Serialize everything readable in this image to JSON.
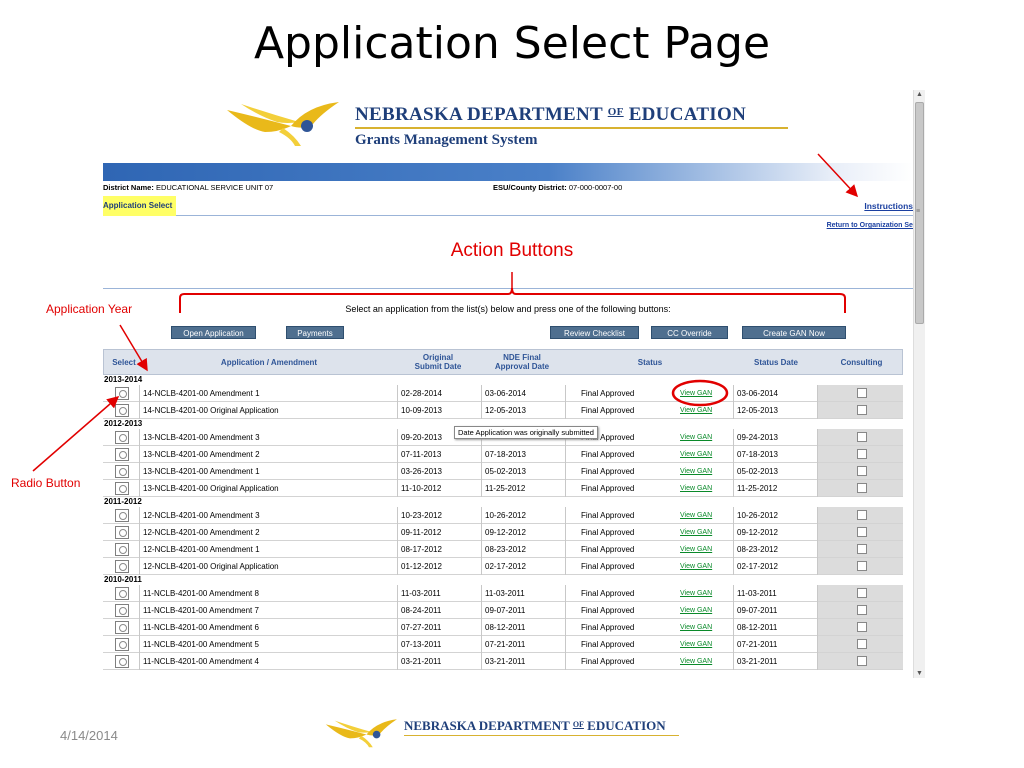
{
  "slide": {
    "title": "Application Select Page",
    "date": "4/14/2014"
  },
  "header": {
    "org_name": "NEBRASKA DEPARTMENT",
    "org_of": "OF",
    "org_dept": "EDUCATION",
    "system_name": "Grants Management System"
  },
  "context": {
    "district_label": "District Name:",
    "district_value": "EDUCATIONAL SERVICE UNIT 07",
    "esu_label": "ESU/County District:",
    "esu_value": "07-000-0007-00"
  },
  "nav": {
    "crumb": "Application Select",
    "instructions": "Instructions",
    "return_link": "Return to Organization Select"
  },
  "prompt": "Select an application from the list(s) below and press one of the following buttons:",
  "buttons": {
    "open": "Open Application",
    "payments": "Payments",
    "review": "Review Checklist",
    "cc_override": "CC Override",
    "create_gan": "Create GAN Now"
  },
  "table": {
    "headers": {
      "select": "Select",
      "application": "Application / Amendment",
      "submit_1": "Original",
      "submit_2": "Submit Date",
      "approval_1": "NDE Final",
      "approval_2": "Approval Date",
      "status": "Status",
      "status_date": "Status Date",
      "consulting": "Consulting"
    },
    "groups": [
      {
        "year": "2013-2014",
        "rows": [
          {
            "app": "14-NCLB-4201-00 Amendment 1",
            "submit": "02-28-2014",
            "approval": "03-06-2014",
            "status": "Final Approved",
            "gan": "View GAN",
            "status_date": "03-06-2014"
          },
          {
            "app": "14-NCLB-4201-00 Original Application",
            "submit": "10-09-2013",
            "approval": "12-05-2013",
            "status": "Final Approved",
            "gan": "View GAN",
            "status_date": "12-05-2013"
          }
        ]
      },
      {
        "year": "2012-2013",
        "rows": [
          {
            "app": "13-NCLB-4201-00 Amendment 3",
            "submit": "09-20-2013",
            "approval": "",
            "status": "Final Approved",
            "gan": "View GAN",
            "status_date": "09-24-2013"
          },
          {
            "app": "13-NCLB-4201-00 Amendment 2",
            "submit": "07-11-2013",
            "approval": "07-18-2013",
            "status": "Final Approved",
            "gan": "View GAN",
            "status_date": "07-18-2013"
          },
          {
            "app": "13-NCLB-4201-00 Amendment 1",
            "submit": "03-26-2013",
            "approval": "05-02-2013",
            "status": "Final Approved",
            "gan": "View GAN",
            "status_date": "05-02-2013"
          },
          {
            "app": "13-NCLB-4201-00 Original Application",
            "submit": "11-10-2012",
            "approval": "11-25-2012",
            "status": "Final Approved",
            "gan": "View GAN",
            "status_date": "11-25-2012"
          }
        ]
      },
      {
        "year": "2011-2012",
        "rows": [
          {
            "app": "12-NCLB-4201-00 Amendment 3",
            "submit": "10-23-2012",
            "approval": "10-26-2012",
            "status": "Final Approved",
            "gan": "View GAN",
            "status_date": "10-26-2012"
          },
          {
            "app": "12-NCLB-4201-00 Amendment 2",
            "submit": "09-11-2012",
            "approval": "09-12-2012",
            "status": "Final Approved",
            "gan": "View GAN",
            "status_date": "09-12-2012"
          },
          {
            "app": "12-NCLB-4201-00 Amendment 1",
            "submit": "08-17-2012",
            "approval": "08-23-2012",
            "status": "Final Approved",
            "gan": "View GAN",
            "status_date": "08-23-2012"
          },
          {
            "app": "12-NCLB-4201-00 Original Application",
            "submit": "01-12-2012",
            "approval": "02-17-2012",
            "status": "Final Approved",
            "gan": "View GAN",
            "status_date": "02-17-2012"
          }
        ]
      },
      {
        "year": "2010-2011",
        "rows": [
          {
            "app": "11-NCLB-4201-00 Amendment 8",
            "submit": "11-03-2011",
            "approval": "11-03-2011",
            "status": "Final Approved",
            "gan": "View GAN",
            "status_date": "11-03-2011"
          },
          {
            "app": "11-NCLB-4201-00 Amendment 7",
            "submit": "08-24-2011",
            "approval": "09-07-2011",
            "status": "Final Approved",
            "gan": "View GAN",
            "status_date": "09-07-2011"
          },
          {
            "app": "11-NCLB-4201-00 Amendment 6",
            "submit": "07-27-2011",
            "approval": "08-12-2011",
            "status": "Final Approved",
            "gan": "View GAN",
            "status_date": "08-12-2011"
          },
          {
            "app": "11-NCLB-4201-00 Amendment 5",
            "submit": "07-13-2011",
            "approval": "07-21-2011",
            "status": "Final Approved",
            "gan": "View GAN",
            "status_date": "07-21-2011"
          },
          {
            "app": "11-NCLB-4201-00 Amendment 4",
            "submit": "03-21-2011",
            "approval": "03-21-2011",
            "status": "Final Approved",
            "gan": "View GAN",
            "status_date": "03-21-2011"
          }
        ]
      }
    ]
  },
  "tooltip": "Date Application was originally submitted",
  "annotations": {
    "action_buttons": "Action Buttons",
    "application_year": "Application Year",
    "radio_button": "Radio Button"
  },
  "colors": {
    "annotation": "#e10000",
    "nde_blue": "#1f3f7a",
    "nde_gold": "#d8b230",
    "button": "#4f6f8f",
    "link_green": "#0a8a2a",
    "crumb_highlight": "#ffff66"
  }
}
